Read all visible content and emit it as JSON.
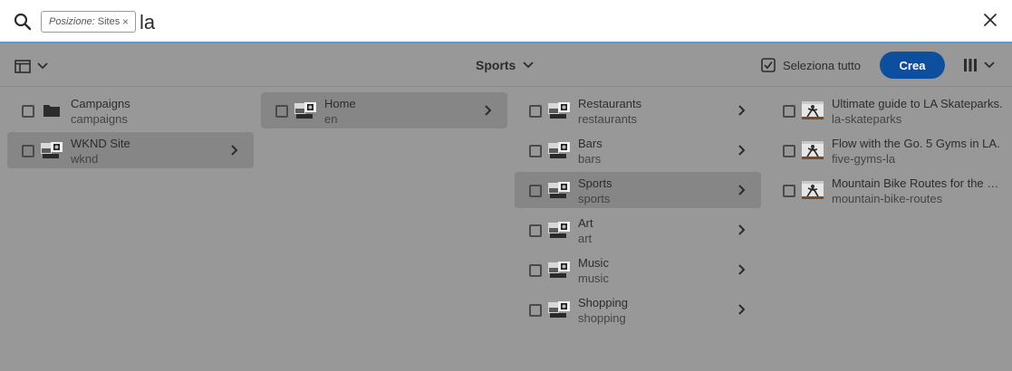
{
  "search": {
    "tag_key": "Posizione:",
    "tag_value": "Sites",
    "tag_remove": "×",
    "query": "la"
  },
  "header": {
    "title": "Sports",
    "select_all_label": "Seleziona tutto",
    "create_label": "Crea"
  },
  "columns": {
    "col1": [
      {
        "title": "Campaigns",
        "name": "campaigns",
        "icon": "folder-icon",
        "selected": false,
        "has_children": false
      },
      {
        "title": "WKND Site",
        "name": "wknd",
        "icon": "page-thumbnail-icon",
        "selected": true,
        "has_children": true
      }
    ],
    "col2": [
      {
        "title": "Home",
        "name": "en",
        "icon": "page-thumbnail-icon",
        "selected": true,
        "has_children": true
      }
    ],
    "col3": [
      {
        "title": "Restaurants",
        "name": "restaurants",
        "selected": false
      },
      {
        "title": "Bars",
        "name": "bars",
        "selected": false
      },
      {
        "title": "Sports",
        "name": "sports",
        "selected": true
      },
      {
        "title": "Art",
        "name": "art",
        "selected": false
      },
      {
        "title": "Music",
        "name": "music",
        "selected": false
      },
      {
        "title": "Shopping",
        "name": "shopping",
        "selected": false
      }
    ],
    "col4": [
      {
        "title": "Ultimate guide to LA Skateparks.",
        "name": "la-skateparks"
      },
      {
        "title": "Flow with the Go. 5 Gyms in LA.",
        "name": "five-gyms-la"
      },
      {
        "title": "Mountain Bike Routes for the Beginner",
        "name": "mountain-bike-routes"
      }
    ]
  },
  "colors": {
    "overlay": "#989898",
    "accent": "#0d4f9e",
    "focus_line": "#5c97d6",
    "selected_row": "#868686"
  }
}
